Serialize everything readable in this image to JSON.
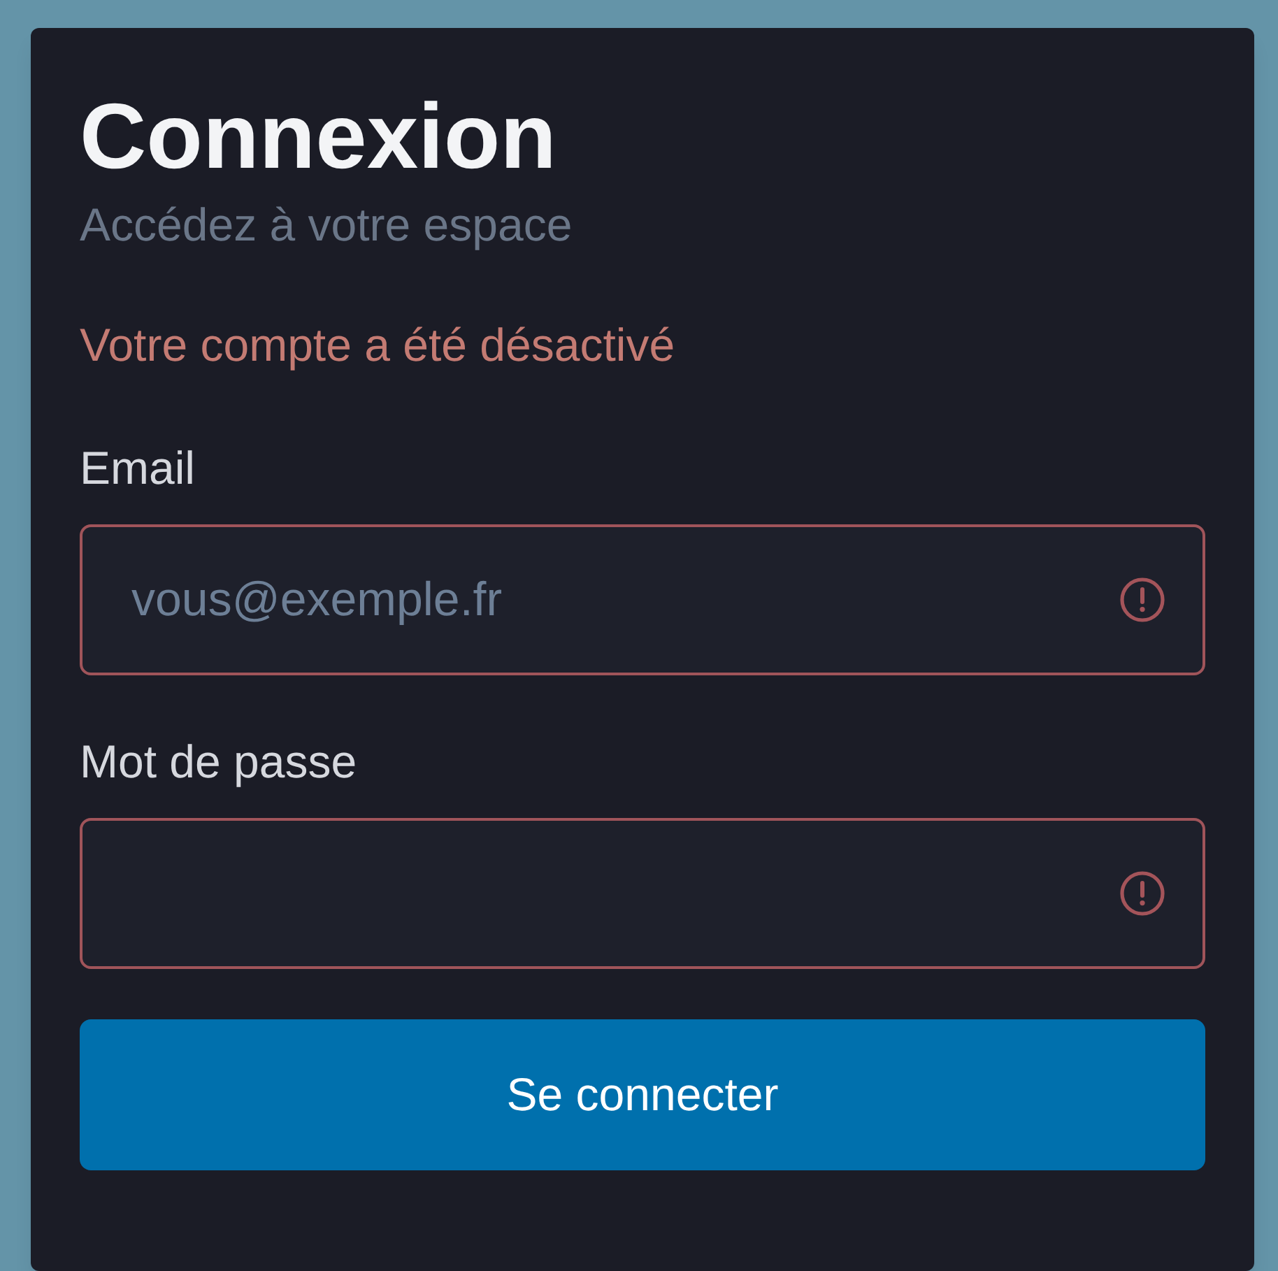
{
  "card": {
    "title": "Connexion",
    "subtitle": "Accédez à votre espace",
    "error": "Votre compte a été désactivé",
    "fields": [
      {
        "label": "Email",
        "placeholder": "vous@exemple.fr",
        "invalid": true
      },
      {
        "label": "Mot de passe",
        "invalid": true
      }
    ],
    "submit": "Se connecter"
  }
}
